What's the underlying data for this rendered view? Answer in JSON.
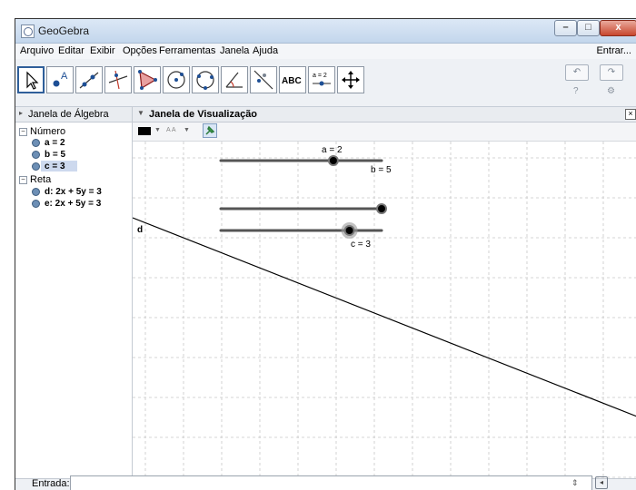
{
  "window": {
    "title": "GeoGebra",
    "close_glyph": "x"
  },
  "menu": [
    "Arquivo",
    "Editar",
    "Exibir",
    "Opções",
    "Ferramentas",
    "Janela",
    "Ajuda"
  ],
  "login_label": "Entrar...",
  "toolbar": {
    "tools": [
      "move-tool-icon",
      "point-tool-icon",
      "line-tool-icon",
      "perpendicular-line-tool-icon",
      "polygon-tool-icon",
      "circle-tool-icon",
      "circle-three-points-tool-icon",
      "angle-tool-icon",
      "reflect-tool-icon",
      "text-tool-icon",
      "slider-tool-icon",
      "move-graphics-tool-icon"
    ],
    "text_tool_label": "ABC",
    "slider_tool_label": "a = 2",
    "undo_glyph": "↶",
    "redo_glyph": "↷",
    "help_glyph": "?",
    "settings_glyph": "⚙"
  },
  "algebra": {
    "header": "Janela de Álgebra",
    "groups": [
      {
        "name": "Número",
        "items": [
          "a = 2",
          "b = 5",
          "c = 3"
        ]
      },
      {
        "name": "Reta",
        "items": [
          "d: 2x + 5y = 3",
          "e: 2x + 5y = 3"
        ]
      }
    ]
  },
  "graphics": {
    "header": "Janela de Visualização",
    "font_size_label": "A A",
    "line_label": "d",
    "sliders": [
      {
        "label": "a = 2",
        "value": 2,
        "min": -5,
        "max": 5
      },
      {
        "label": "b = 5",
        "value": 5,
        "min": -5,
        "max": 5
      },
      {
        "label": "c = 3",
        "value": 3,
        "min": -5,
        "max": 5
      }
    ]
  },
  "input_bar": {
    "label": "Entrada:",
    "value": ""
  }
}
